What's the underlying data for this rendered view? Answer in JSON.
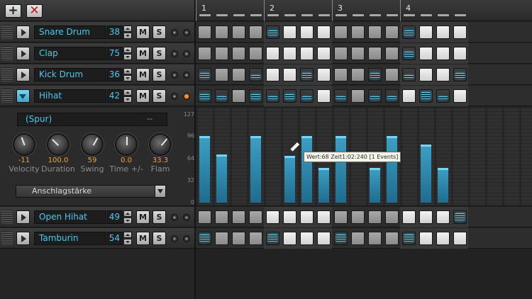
{
  "toolbar": {
    "add_label": "+",
    "delete_label": "✕"
  },
  "ruler": {
    "bars": [
      "1",
      "2",
      "3",
      "4"
    ],
    "steps_per_bar": 4
  },
  "tracks": [
    {
      "name": "Snare Drum",
      "note": "38",
      "mute": "M",
      "solo": "S",
      "expanded": false,
      "steps": [
        0,
        0,
        0,
        0,
        2,
        0,
        0,
        0,
        0,
        0,
        0,
        0,
        2,
        0,
        0,
        0
      ]
    },
    {
      "name": "Clap",
      "note": "75",
      "mute": "M",
      "solo": "S",
      "expanded": false,
      "steps": [
        0,
        0,
        0,
        0,
        0,
        0,
        0,
        0,
        0,
        0,
        0,
        0,
        2,
        0,
        0,
        0
      ]
    },
    {
      "name": "Kick Drum",
      "note": "36",
      "mute": "M",
      "solo": "S",
      "expanded": false,
      "steps": [
        2,
        0,
        0,
        1,
        0,
        0,
        2,
        0,
        0,
        0,
        2,
        0,
        1,
        0,
        0,
        2
      ]
    },
    {
      "name": "Hihat",
      "note": "42",
      "mute": "M",
      "solo": "S",
      "expanded": true,
      "steps": [
        2,
        1,
        0,
        2,
        1,
        2,
        1,
        0,
        1,
        0,
        1,
        1,
        0,
        3,
        1,
        0
      ]
    },
    {
      "name": "Open Hihat",
      "note": "49",
      "mute": "M",
      "solo": "S",
      "expanded": false,
      "steps": [
        0,
        0,
        0,
        0,
        0,
        0,
        0,
        0,
        0,
        0,
        0,
        0,
        0,
        0,
        0,
        3
      ]
    },
    {
      "name": "Tamburin",
      "note": "54",
      "mute": "M",
      "solo": "S",
      "expanded": false,
      "steps": [
        3,
        0,
        0,
        0,
        3,
        0,
        0,
        0,
        3,
        0,
        0,
        0,
        3,
        0,
        0,
        0
      ]
    }
  ],
  "panel": {
    "spur_label": "(Spur)",
    "spur_value": "--",
    "knobs": [
      {
        "label": "Velocity",
        "value": "-11",
        "angle": -20
      },
      {
        "label": "Duration",
        "value": "100.0",
        "angle": -45
      },
      {
        "label": "Swing",
        "value": "59",
        "angle": 30
      },
      {
        "label": "Time +/-",
        "value": "0.0",
        "angle": 0
      },
      {
        "label": "Flam",
        "value": "33.3",
        "angle": 40
      }
    ],
    "dropdown_value": "Anschlagstärke"
  },
  "velocity_editor": {
    "y_ticks": [
      "127",
      "96",
      "64",
      "32",
      "0"
    ],
    "velocities": [
      96,
      70,
      null,
      96,
      null,
      68,
      96,
      50,
      96,
      null,
      50,
      96,
      null,
      84,
      50,
      null
    ],
    "tooltip": "Wert:68 Zeit1:02:240 [1 Events]"
  }
}
